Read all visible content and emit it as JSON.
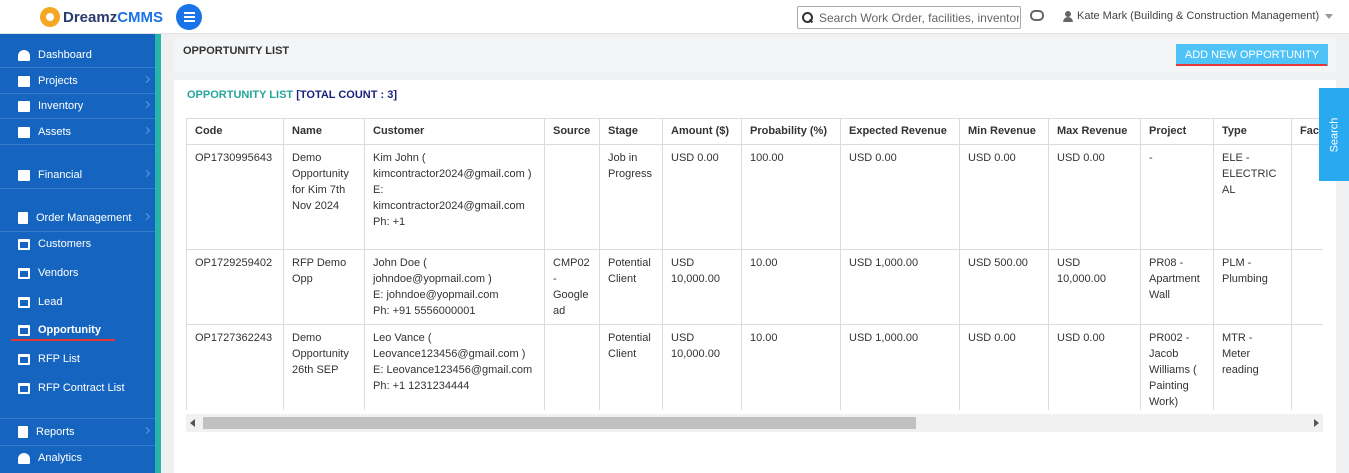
{
  "app": {
    "logo_part1": "Dreamz",
    "logo_part2": "CMMS"
  },
  "header": {
    "search_placeholder": "Search Work Order, facilities, inventory",
    "user_label": "Kate Mark (Building & Construction Management)"
  },
  "sidebar": {
    "items": [
      {
        "label": "Dashboard"
      },
      {
        "label": "Projects"
      },
      {
        "label": "Inventory"
      },
      {
        "label": "Assets"
      },
      {
        "label": "Financial"
      },
      {
        "label": "Order Management"
      },
      {
        "label": "Customers"
      },
      {
        "label": "Vendors"
      },
      {
        "label": "Lead"
      },
      {
        "label": "Opportunity"
      },
      {
        "label": "RFP List"
      },
      {
        "label": "RFP Contract List"
      },
      {
        "label": "Reports"
      },
      {
        "label": "Analytics"
      }
    ]
  },
  "page": {
    "title": "OPPORTUNITY LIST",
    "add_button": "ADD NEW OPPORTUNITY",
    "list_caption": "OPPORTUNITY LIST",
    "total_count": "[TOTAL COUNT : 3]",
    "search_tab": "Search"
  },
  "table": {
    "headers": [
      "Code",
      "Name",
      "Customer",
      "Source",
      "Stage",
      "Amount ($)",
      "Probability (%)",
      "Expected Revenue",
      "Min Revenue",
      "Max Revenue",
      "Project",
      "Type",
      "Fac"
    ],
    "rows": [
      {
        "code": "OP1730995643",
        "name": "Demo Opportunity for Kim 7th Nov 2024",
        "customer_name": "Kim John ( kimcontractor2024@gmail.com )",
        "customer_email": "E: kimcontractor2024@gmail.com",
        "customer_phone": "Ph: +1",
        "source": "",
        "stage": "Job in Progress",
        "amount": "USD 0.00",
        "probability": "100.00",
        "expected_revenue": "USD 0.00",
        "min_revenue": "USD 0.00",
        "max_revenue": "USD 0.00",
        "project": "-",
        "type": "ELE - ELECTRICAL",
        "fac": ""
      },
      {
        "code": "OP1729259402",
        "name": "RFP Demo Opp",
        "customer_name": "John Doe ( johndoe@yopmail.com )",
        "customer_email": "E: johndoe@yopmail.com",
        "customer_phone": "Ph: +91 5556000001",
        "source": "CMP02 - Google ad",
        "stage": "Potential Client",
        "amount": "USD 10,000.00",
        "probability": "10.00",
        "expected_revenue": "USD 1,000.00",
        "min_revenue": "USD 500.00",
        "max_revenue": "USD 10,000.00",
        "project": "PR08 - Apartment Wall",
        "type": "PLM - Plumbing",
        "fac": ""
      },
      {
        "code": "OP1727362243",
        "name": "Demo Opportunity 26th SEP",
        "customer_name": "Leo Vance ( Leovance123456@gmail.com )",
        "customer_email": "E: Leovance123456@gmail.com",
        "customer_phone": "Ph: +1 1231234444",
        "source": "",
        "stage": "Potential Client",
        "amount": "USD 10,000.00",
        "probability": "10.00",
        "expected_revenue": "USD 1,000.00",
        "min_revenue": "USD 0.00",
        "max_revenue": "USD 0.00",
        "project": "PR002 - Jacob Williams ( Painting Work)",
        "type": "MTR - Meter reading",
        "fac": ""
      }
    ]
  }
}
